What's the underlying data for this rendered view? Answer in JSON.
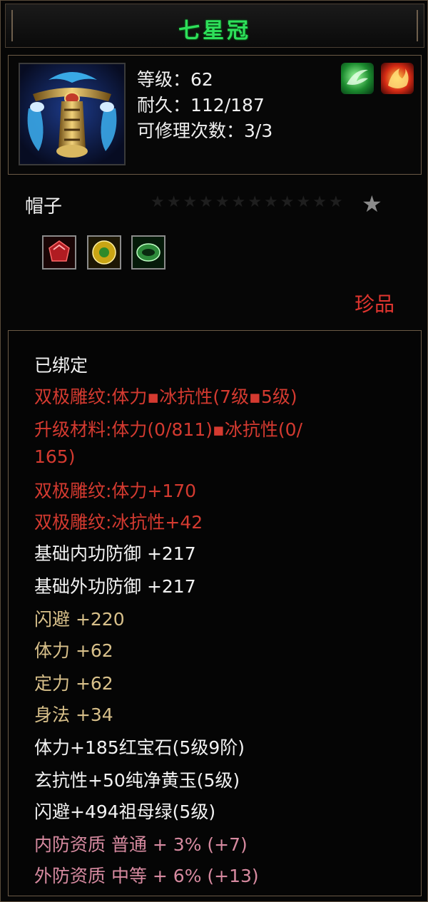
{
  "item": {
    "name": "七星冠",
    "level": "等级：62",
    "durability": "耐久：112/187",
    "repairs": "可修理次数：3/3",
    "type": "帽子",
    "rarity": "珍品",
    "icon": "crown-icon"
  },
  "header_icons": [
    "wind-element-icon",
    "fire-element-icon"
  ],
  "gems": [
    {
      "name": "ruby-gem-icon",
      "color": "#b01c22"
    },
    {
      "name": "yellow-jade-gem-icon",
      "color": "#c9a514"
    },
    {
      "name": "emerald-gem-icon",
      "color": "#2d8a3a"
    }
  ],
  "stars": "★★★★★★★★★★★★",
  "colors": {
    "title": "#2ee05a",
    "red": "#d43a30",
    "gold": "#d8c08a",
    "pink": "#d78aa0"
  },
  "attributes": [
    {
      "text": "已绑定",
      "style": "white"
    },
    {
      "text": "双极雕纹:体力▪冰抗性(7级▪5级)",
      "style": "red"
    },
    {
      "text": "升级材料:体力(0/811)▪冰抗性(0/",
      "style": "red"
    },
    {
      "text": "165)",
      "style": "red"
    },
    {
      "text": "双极雕纹:体力+170",
      "style": "red"
    },
    {
      "text": "双极雕纹:冰抗性+42",
      "style": "red"
    },
    {
      "text": "基础内功防御 +217",
      "style": "white"
    },
    {
      "text": "基础外功防御 +217",
      "style": "white"
    },
    {
      "text": "闪避 +220",
      "style": "gold"
    },
    {
      "text": "体力 +62",
      "style": "gold"
    },
    {
      "text": "定力 +62",
      "style": "gold"
    },
    {
      "text": "身法 +34",
      "style": "gold"
    },
    {
      "text": "体力+185红宝石(5级9阶)",
      "style": "white"
    },
    {
      "text": "玄抗性+50纯净黄玉(5级)",
      "style": "white"
    },
    {
      "text": "闪避+494祖母绿(5级)",
      "style": "white"
    },
    {
      "text": "内防资质 普通 + 3% (+7)",
      "style": "pink"
    },
    {
      "text": "外防资质 中等 + 6% (+13)",
      "style": "pink"
    }
  ]
}
